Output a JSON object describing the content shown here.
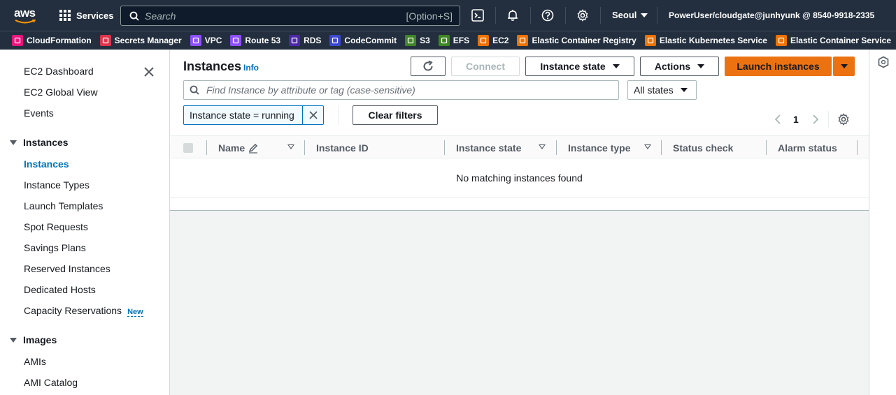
{
  "topbar": {
    "logo_text": "aws",
    "services_label": "Services",
    "search_placeholder": "Search",
    "search_shortcut": "[Option+S]",
    "region_label": "Seoul",
    "account_label": "PowerUser/cloudgate@junhyunk @ 8540-9918-2335",
    "icons": [
      "cloudshell-icon",
      "bell-icon",
      "help-icon",
      "settings-gear-icon"
    ]
  },
  "favorites": [
    {
      "label": "CloudFormation",
      "color": "#e7157b"
    },
    {
      "label": "Secrets Manager",
      "color": "#dd344c"
    },
    {
      "label": "VPC",
      "color": "#8c4fff"
    },
    {
      "label": "Route 53",
      "color": "#8c4fff"
    },
    {
      "label": "RDS",
      "color": "#4d27aa"
    },
    {
      "label": "CodeCommit",
      "color": "#3b48cc"
    },
    {
      "label": "S3",
      "color": "#3f8624"
    },
    {
      "label": "EFS",
      "color": "#3f8624"
    },
    {
      "label": "EC2",
      "color": "#ed7100"
    },
    {
      "label": "Elastic Container Registry",
      "color": "#ed7100"
    },
    {
      "label": "Elastic Kubernetes Service",
      "color": "#ed7100"
    },
    {
      "label": "Elastic Container Service",
      "color": "#ed7100"
    }
  ],
  "sidebar": {
    "top_items": [
      "EC2 Dashboard",
      "EC2 Global View",
      "Events"
    ],
    "sections": [
      {
        "title": "Instances",
        "items": [
          "Instances",
          "Instance Types",
          "Launch Templates",
          "Spot Requests",
          "Savings Plans",
          "Reserved Instances",
          "Dedicated Hosts",
          "Capacity Reservations"
        ],
        "active": "Instances",
        "new_badge": "New"
      },
      {
        "title": "Images",
        "items": [
          "AMIs",
          "AMI Catalog"
        ]
      }
    ]
  },
  "main": {
    "title": "Instances",
    "info_link": "Info",
    "buttons": {
      "connect": "Connect",
      "instance_state": "Instance state",
      "actions": "Actions",
      "launch": "Launch instances",
      "clear_filters": "Clear filters"
    },
    "finder_placeholder": "Find Instance by attribute or tag (case-sensitive)",
    "states_select": "All states",
    "filter_chip": "Instance state = running",
    "page_number": "1",
    "columns": [
      "Name",
      "Instance ID",
      "Instance state",
      "Instance type",
      "Status check",
      "Alarm status"
    ],
    "empty_message": "No matching instances found"
  },
  "colors": {
    "nav_bg": "#232f3e",
    "accent_blue": "#0073bb",
    "primary_orange": "#ec7211"
  }
}
